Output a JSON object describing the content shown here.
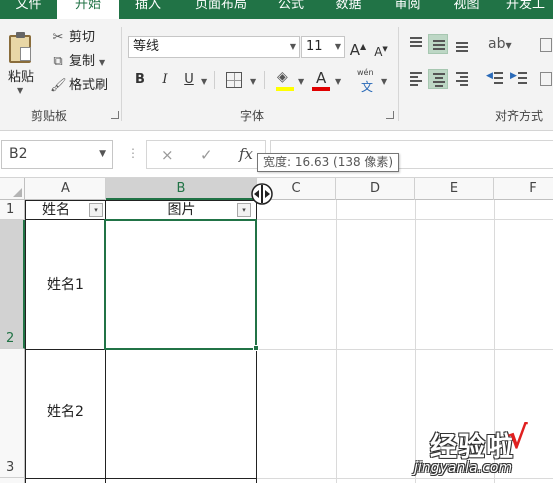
{
  "ribbon_tabs": [
    {
      "label": "文件",
      "active": false
    },
    {
      "label": "开始",
      "active": true
    },
    {
      "label": "插入",
      "active": false
    },
    {
      "label": "页面布局",
      "active": false
    },
    {
      "label": "公式",
      "active": false
    },
    {
      "label": "数据",
      "active": false
    },
    {
      "label": "审阅",
      "active": false
    },
    {
      "label": "视图",
      "active": false
    },
    {
      "label": "开发工",
      "active": false
    }
  ],
  "clipboard": {
    "paste_label": "粘贴",
    "cut_label": "剪切",
    "copy_label": "复制",
    "format_painter_label": "格式刷",
    "group_label": "剪贴板"
  },
  "font": {
    "font_name": "等线",
    "font_size": "11",
    "grow_label": "A",
    "shrink_label": "A",
    "bold_label": "B",
    "italic_label": "I",
    "underline_label": "U",
    "font_color_label": "A",
    "phonetic_label": "wén",
    "group_label": "字体",
    "fill_color": "#ffff00",
    "font_color": "#e00000"
  },
  "alignment": {
    "group_label": "对齐方式"
  },
  "formula_bar": {
    "name_box": "B2",
    "cancel_icon": "×",
    "enter_icon": "✓",
    "fx_label": "fx",
    "content": ""
  },
  "tooltip": "宽度: 16.63 (138 像素)",
  "columns": [
    "A",
    "B",
    "C",
    "D",
    "E",
    "F"
  ],
  "selected_column": "B",
  "rows": [
    {
      "header": "1",
      "cells": [
        "姓名",
        "图片"
      ]
    },
    {
      "header": "2",
      "cells": [
        "姓名1",
        ""
      ]
    },
    {
      "header": "3",
      "cells": [
        "姓名2",
        ""
      ]
    }
  ],
  "selected_cell": "B2",
  "watermark": {
    "text": "经验啦",
    "check": "√",
    "url": "jingyanla.com"
  },
  "colors": {
    "accent": "#217346",
    "selection_header": "#d2d2d2"
  }
}
